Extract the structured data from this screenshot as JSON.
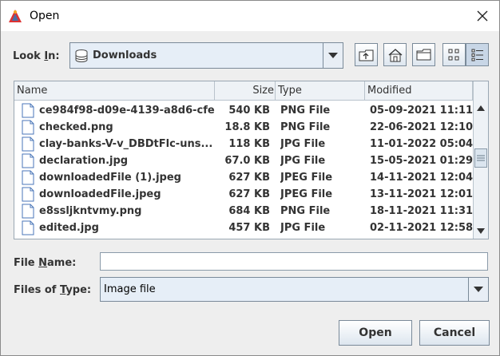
{
  "window": {
    "title": "Open"
  },
  "lookin": {
    "label_pre": "Look ",
    "label_ul": "I",
    "label_post": "n:",
    "value": "Downloads"
  },
  "toolbar": {
    "up": "up-folder",
    "home": "home",
    "new_folder": "new-folder",
    "list_view": "list-view",
    "details_view": "details-view"
  },
  "filelist": {
    "columns": [
      "Name",
      "Size",
      "Type",
      "Modified"
    ],
    "rows": [
      {
        "name": "ce984f98-d09e-4139-a8d6-cfe...",
        "size": "540 KB",
        "type": "PNG File",
        "modified": "05-09-2021 11:11..."
      },
      {
        "name": "checked.png",
        "size": "18.8 KB",
        "type": "PNG File",
        "modified": "22-06-2021 12:10..."
      },
      {
        "name": "clay-banks-V-v_DBDtFlc-uns...",
        "size": "118 KB",
        "type": "JPG File",
        "modified": "11-01-2022 05:04..."
      },
      {
        "name": "declaration.jpg",
        "size": "67.0 KB",
        "type": "JPG File",
        "modified": "15-05-2021 01:29..."
      },
      {
        "name": "downloadedFile (1).jpeg",
        "size": "627 KB",
        "type": "JPEG File",
        "modified": "14-11-2021 12:04..."
      },
      {
        "name": "downloadedFile.jpeg",
        "size": "627 KB",
        "type": "JPEG File",
        "modified": "13-11-2021 12:01..."
      },
      {
        "name": "e8ssljkntvmy.png",
        "size": "684 KB",
        "type": "PNG File",
        "modified": "18-11-2021 11:31..."
      },
      {
        "name": "edited.jpg",
        "size": "457 KB",
        "type": "JPG File",
        "modified": "02-11-2021 12:58..."
      }
    ]
  },
  "filename": {
    "label_pre": "File ",
    "label_ul": "N",
    "label_post": "ame:",
    "value": ""
  },
  "filetype": {
    "label_pre": "Files of ",
    "label_ul": "T",
    "label_post": "ype:",
    "value": "Image file"
  },
  "buttons": {
    "open": "Open",
    "cancel": "Cancel"
  },
  "colors": {
    "accent": "#7a8a99",
    "header_bg": "#eef2f6",
    "combo_bg": "#e6eef7"
  }
}
